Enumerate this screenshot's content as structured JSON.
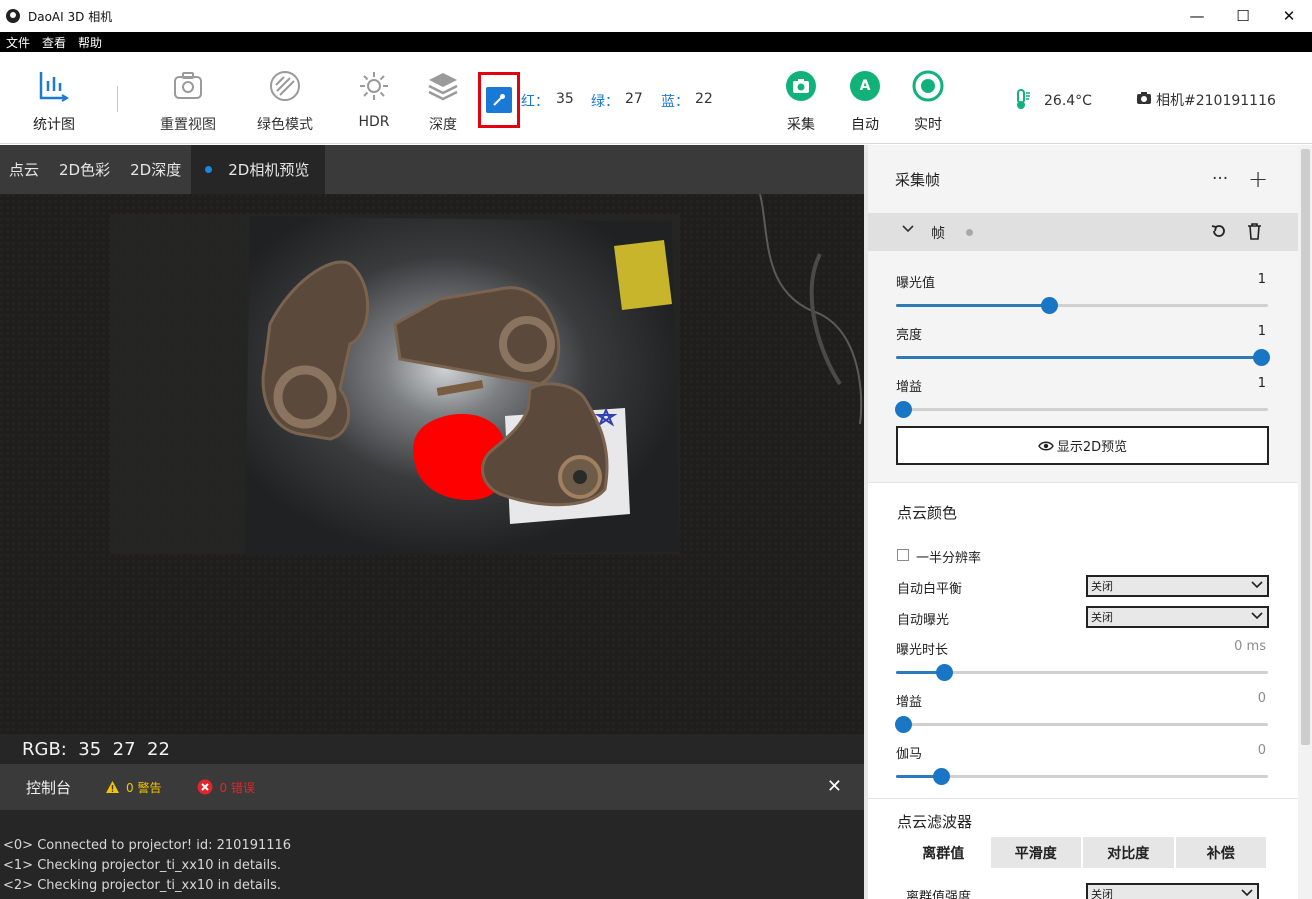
{
  "window": {
    "title": "DaoAI 3D 相机",
    "minimize": "—",
    "maximize": "☐",
    "close": "✕"
  },
  "menu": [
    "文件",
    "查看",
    "帮助"
  ],
  "toolbar": {
    "stats": "统计图",
    "reset_view": "重置视图",
    "green_mode": "绿色模式",
    "hdr": "HDR",
    "depth": "深度",
    "rgb_readout": {
      "r_label": "红：",
      "r_value": "35",
      "g_label": "绿：",
      "g_value": "27",
      "b_label": "蓝：",
      "b_value": "22"
    },
    "capture": "采集",
    "auto": "自动",
    "auto_glyph": "A",
    "live": "实时",
    "temperature": "26.4°C",
    "camera": "相机#210191116"
  },
  "view_tabs": [
    "点云",
    "2D色彩",
    "2D深度",
    "2D相机预览"
  ],
  "active_tab": 3,
  "rgb_status": "RGB:  35  27  22",
  "console": {
    "title": "控制台",
    "warnings": "0 警告",
    "errors": "0 错误",
    "lines": [
      "<0> Connected to projector! id: 210191116",
      "<1> Checking projector_ti_xx10 in details.",
      "<2> Checking projector_ti_xx10 in details."
    ]
  },
  "panel": {
    "capture_frame": {
      "title": "采集帧",
      "more": "···",
      "add": "+",
      "frame_label": "帧",
      "sliders": [
        {
          "label": "曝光值",
          "value": "1",
          "fraction": 0.41
        },
        {
          "label": "亮度",
          "value": "1",
          "fraction": 0.98
        },
        {
          "label": "增益",
          "value": "1",
          "fraction": 0.02
        }
      ],
      "show_2d_button": "显示2D预览"
    },
    "point_color": {
      "title": "点云颜色",
      "half_res": "一半分辨率",
      "awb_label": "自动白平衡",
      "awb_value": "关闭",
      "ae_label": "自动曝光",
      "ae_value": "关闭",
      "sliders": [
        {
          "label": "曝光时长",
          "value": "0 ms",
          "fraction": 0.13
        },
        {
          "label": "增益",
          "value": "0",
          "fraction": 0.02
        },
        {
          "label": "伽马",
          "value": "0",
          "fraction": 0.12
        }
      ]
    },
    "filter": {
      "title": "点云滤波器",
      "tabs": [
        "离群值",
        "平滑度",
        "对比度",
        "补偿"
      ],
      "row_label": "离群值强度",
      "row_value": "关闭"
    }
  },
  "colors": {
    "accent_blue": "#1a78d6",
    "green": "#10b27a",
    "slider_blue": "#1976c4",
    "highlight_red": "#e3000f"
  }
}
